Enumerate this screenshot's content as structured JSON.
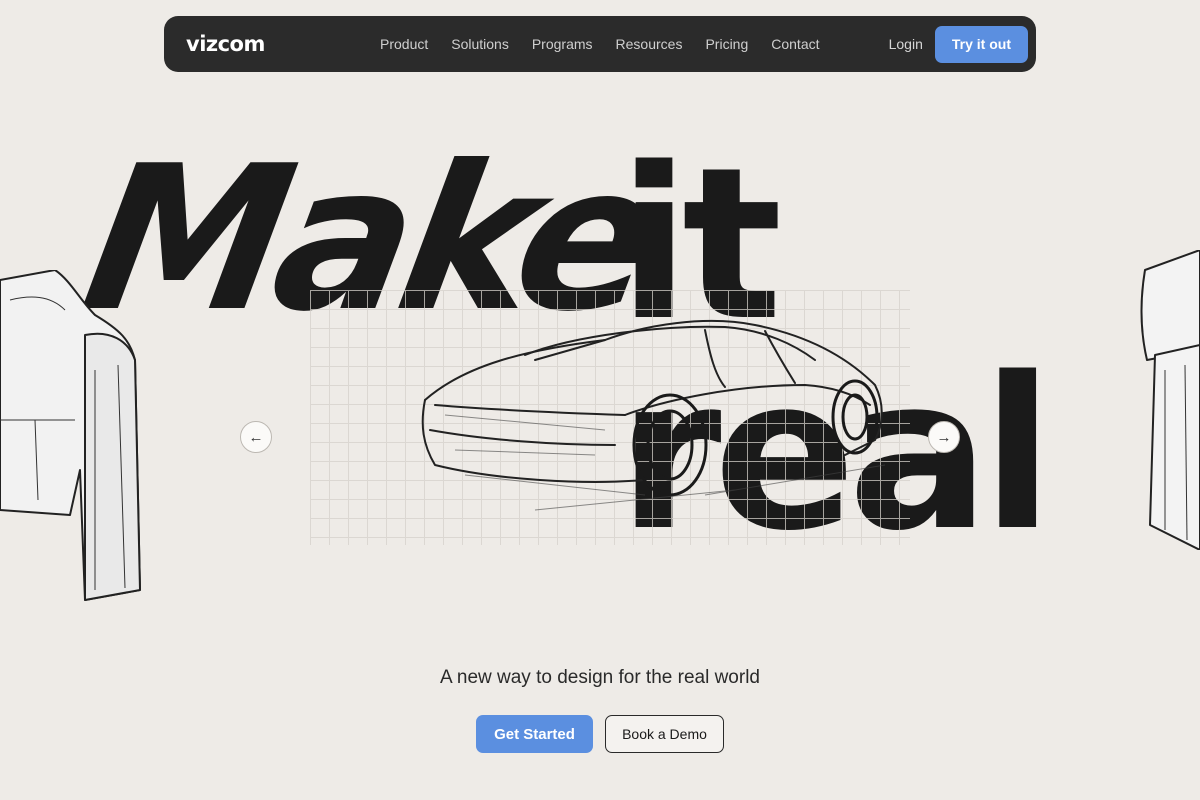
{
  "nav": {
    "logo": "vizcom",
    "items": [
      {
        "label": "Product"
      },
      {
        "label": "Solutions"
      },
      {
        "label": "Programs"
      },
      {
        "label": "Resources"
      },
      {
        "label": "Pricing"
      },
      {
        "label": "Contact"
      }
    ],
    "login": "Login",
    "cta": "Try it out"
  },
  "hero": {
    "headline_part1": "Make",
    "headline_part2": "it real",
    "tagline": "A new way to design for the real world",
    "primary_cta": "Get Started",
    "secondary_cta": "Book a Demo"
  },
  "carousel": {
    "prev_icon": "arrow-left-icon",
    "next_icon": "arrow-right-icon"
  },
  "colors": {
    "background": "#eeebe7",
    "nav_bg": "#2b2b2b",
    "accent": "#5b8fe0",
    "text": "#1a1a1a"
  }
}
